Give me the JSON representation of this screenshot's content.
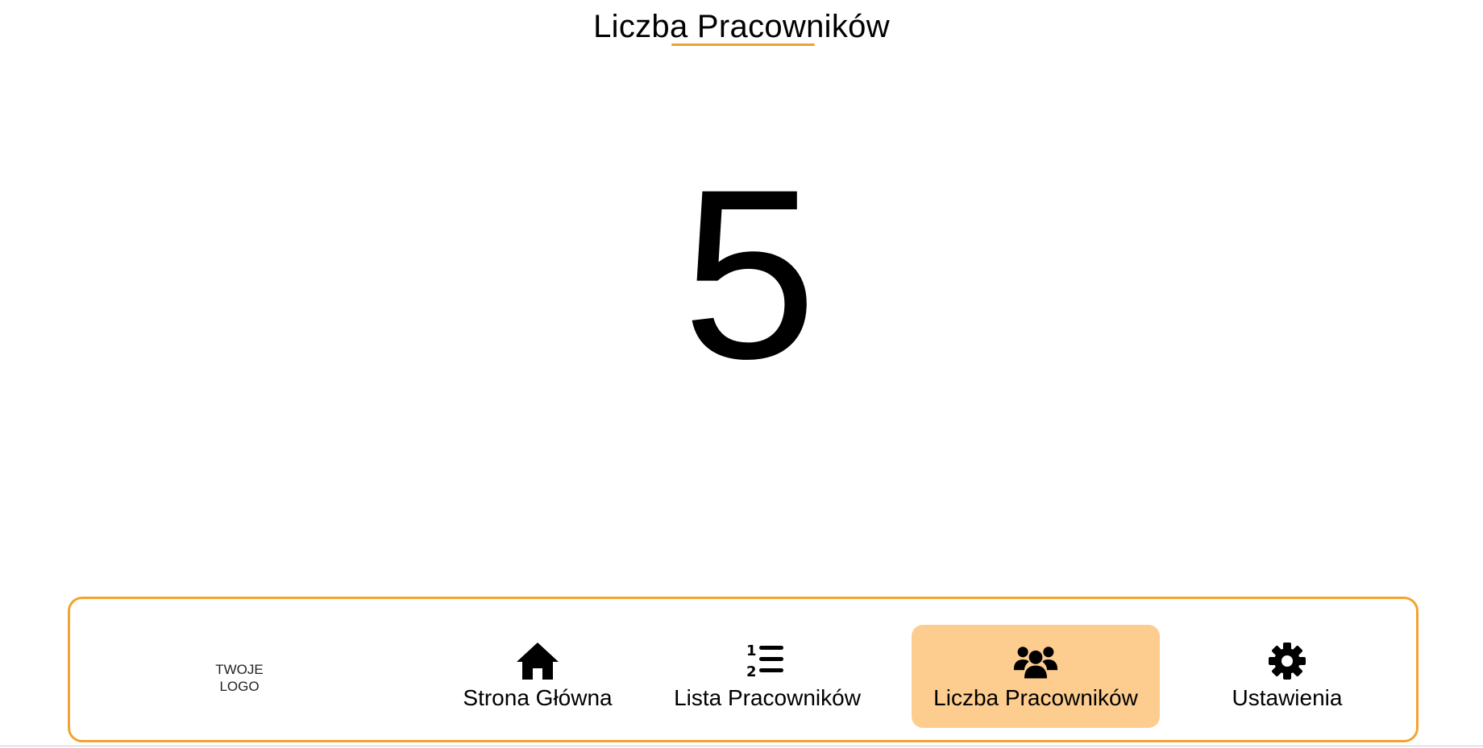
{
  "header": {
    "title": "Liczba Pracowników",
    "accent_color": "#f3a331"
  },
  "main": {
    "employee_count": "5"
  },
  "navbar": {
    "logo_line1": "TWOJE",
    "logo_line2": "LOGO",
    "items": [
      {
        "label": "Strona Główna",
        "icon": "home-icon",
        "active": false
      },
      {
        "label": "Lista Pracowników",
        "icon": "numbered-list-icon",
        "active": false
      },
      {
        "label": "Liczba Pracowników",
        "icon": "users-group-icon",
        "active": true
      },
      {
        "label": "Ustawienia",
        "icon": "gear-icon",
        "active": false
      }
    ],
    "active_bg_color": "#fdcd90"
  }
}
